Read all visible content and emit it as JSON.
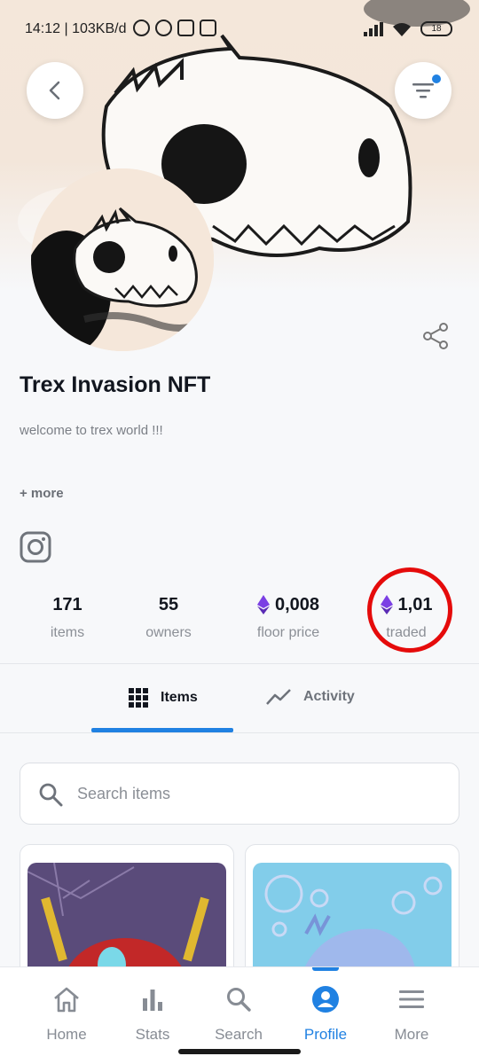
{
  "status_bar": {
    "time_speed": "14:12 | 103KB/d",
    "icons": [
      "alarm-icon",
      "whatsapp-icon",
      "discord-icon",
      "discord-icon"
    ],
    "right_icons": [
      "signal-icon",
      "wifi-icon",
      "battery-icon"
    ],
    "battery": "18"
  },
  "header": {
    "back_icon": "chevron-left-icon",
    "filter_icon": "filter-icon",
    "filter_has_notification": true
  },
  "collection": {
    "title": "Trex Invasion NFT",
    "description": "welcome to trex world !!!",
    "more_label": "+ more",
    "social_icon": "instagram-icon",
    "share_icon": "share-icon"
  },
  "stats": [
    {
      "value": "171",
      "label": "items",
      "eth": false
    },
    {
      "value": "55",
      "label": "owners",
      "eth": false
    },
    {
      "value": "0,008",
      "label": "floor price",
      "eth": true
    },
    {
      "value": "1,01",
      "label": "traded",
      "eth": true,
      "circled": true
    }
  ],
  "tabs": {
    "items_label": "Items",
    "activity_label": "Activity",
    "active": "Items"
  },
  "search": {
    "placeholder": "Search items"
  },
  "bottom_nav": [
    {
      "label": "Home",
      "icon": "home-icon"
    },
    {
      "label": "Stats",
      "icon": "bar-chart-icon"
    },
    {
      "label": "Search",
      "icon": "search-icon"
    },
    {
      "label": "Profile",
      "icon": "profile-icon",
      "active": true
    },
    {
      "label": "More",
      "icon": "menu-icon"
    }
  ],
  "colors": {
    "accent": "#2081e2",
    "highlight_ring": "#e50b0b",
    "eth": "#7b3fe4"
  }
}
